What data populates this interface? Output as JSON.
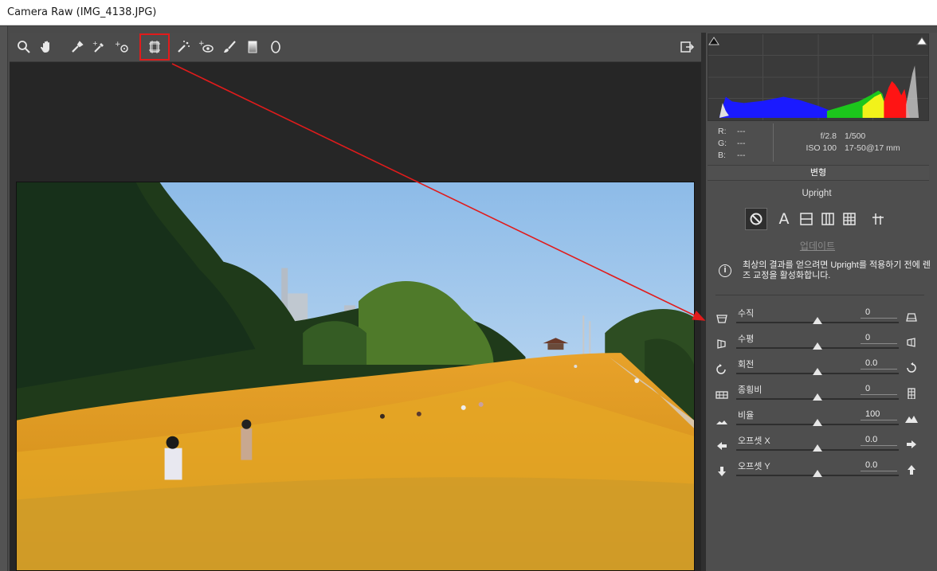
{
  "window": {
    "title": "Camera Raw (IMG_4138.JPG)"
  },
  "toolbar": {
    "tools": [
      {
        "name": "zoom-tool",
        "icon": "magnifier-icon"
      },
      {
        "name": "hand-tool",
        "icon": "hand-icon"
      },
      {
        "name": "white-balance-tool",
        "icon": "eyedropper-icon"
      },
      {
        "name": "color-sampler-tool",
        "icon": "color-sampler-icon"
      },
      {
        "name": "targeted-adjustment-tool",
        "icon": "target-adjust-icon"
      },
      {
        "name": "transform-tool",
        "icon": "transform-icon",
        "highlighted": true
      },
      {
        "name": "spot-removal-tool",
        "icon": "spot-heal-icon"
      },
      {
        "name": "red-eye-tool",
        "icon": "red-eye-icon"
      },
      {
        "name": "adjustment-brush-tool",
        "icon": "brush-icon"
      },
      {
        "name": "graduated-filter-tool",
        "icon": "gradient-icon"
      },
      {
        "name": "radial-filter-tool",
        "icon": "ellipse-icon"
      }
    ],
    "right_icon": "open-preferences-icon"
  },
  "readout": {
    "r_label": "R:",
    "r_value": "---",
    "g_label": "G:",
    "g_value": "---",
    "b_label": "B:",
    "b_value": "---",
    "aperture": "f/2.8",
    "shutter": "1/500",
    "iso": "ISO 100",
    "lens": "17-50@17 mm"
  },
  "section": {
    "title": "변형"
  },
  "upright": {
    "label": "Upright",
    "buttons": [
      {
        "name": "upright-off",
        "icon": "prohibited-icon",
        "selected": true
      },
      {
        "name": "upright-auto",
        "icon": "A"
      },
      {
        "name": "upright-level",
        "icon": "level-icon"
      },
      {
        "name": "upright-vertical",
        "icon": "vertical-icon"
      },
      {
        "name": "upright-full",
        "icon": "grid-icon"
      },
      {
        "name": "upright-guided",
        "icon": "guided-icon"
      }
    ],
    "update_label": "업데이트",
    "info_text": "최상의 결과를 얻으려면 Upright를 적용하기 전에 렌즈 교정을 활성화합니다."
  },
  "sliders": [
    {
      "label": "수직",
      "value": "0",
      "pos": 0.5,
      "icon_left": "vertical-persp-left-icon",
      "icon_right": "vertical-persp-right-icon"
    },
    {
      "label": "수평",
      "value": "0",
      "pos": 0.5,
      "icon_left": "horizontal-persp-left-icon",
      "icon_right": "horizontal-persp-right-icon"
    },
    {
      "label": "회전",
      "value": "0.0",
      "pos": 0.5,
      "icon_left": "rotate-ccw-icon",
      "icon_right": "rotate-cw-icon"
    },
    {
      "label": "종횡비",
      "value": "0",
      "pos": 0.5,
      "icon_left": "aspect-wide-icon",
      "icon_right": "aspect-tall-icon"
    },
    {
      "label": "비율",
      "value": "100",
      "pos": 0.5,
      "icon_left": "scale-small-icon",
      "icon_right": "scale-large-icon"
    },
    {
      "label": "오프셋 X",
      "value": "0.0",
      "pos": 0.5,
      "icon_left": "arrow-left-icon",
      "icon_right": "arrow-right-icon"
    },
    {
      "label": "오프셋 Y",
      "value": "0.0",
      "pos": 0.5,
      "icon_left": "arrow-down-icon",
      "icon_right": "arrow-up-icon"
    }
  ],
  "colors": {
    "highlight": "#e11b1b",
    "panel": "#4e4e4e",
    "canvas": "#262626"
  }
}
